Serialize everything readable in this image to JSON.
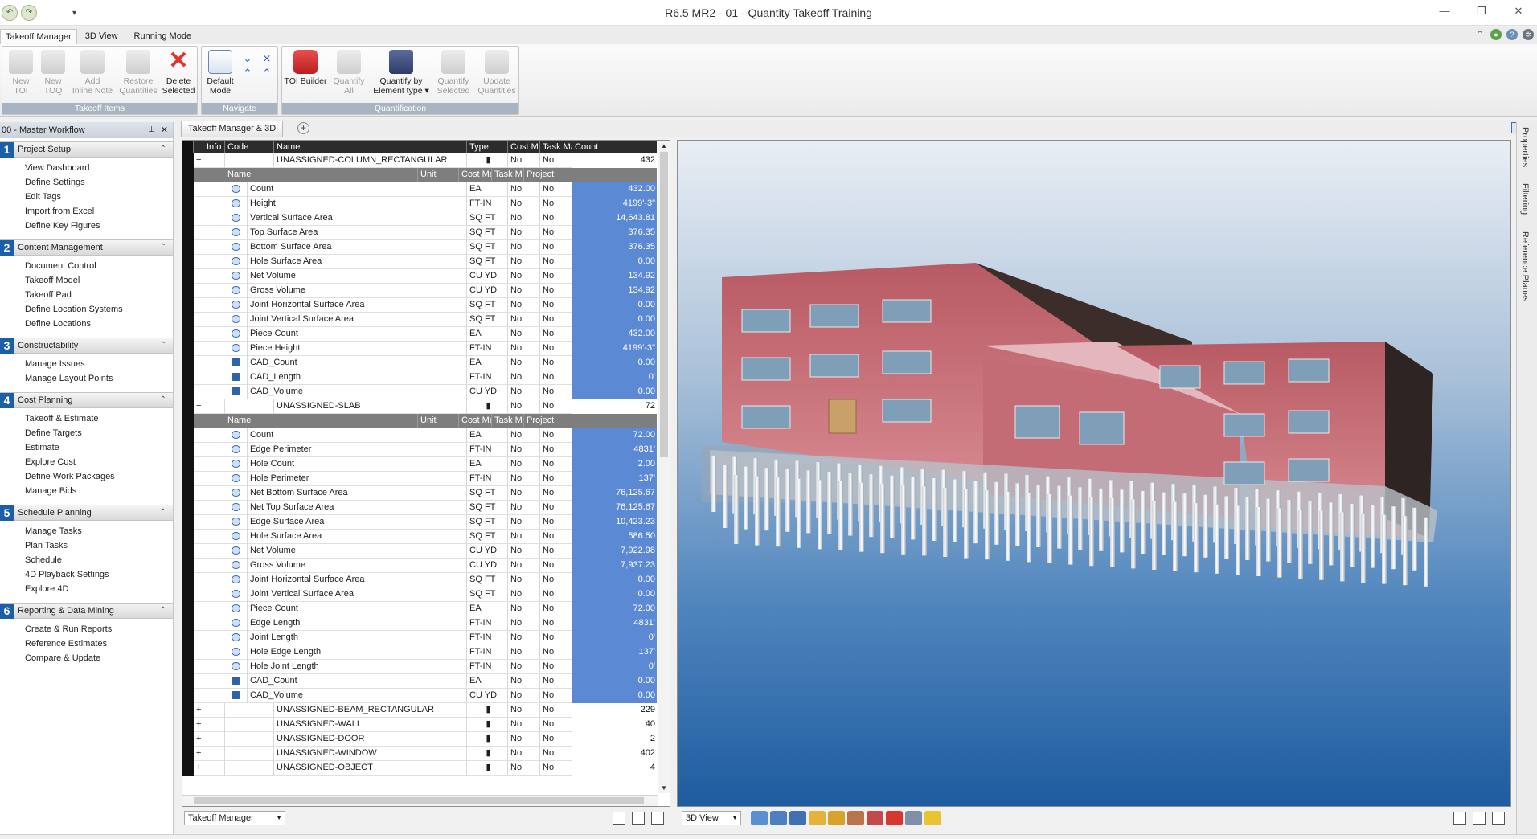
{
  "window": {
    "title": "R6.5 MR2 - 01 - Quantity Takeoff Training"
  },
  "ribbon_tabs": [
    "Takeoff Manager",
    "3D View",
    "Running Mode"
  ],
  "ribbon": {
    "takeoff_items": {
      "label": "Takeoff Items",
      "buttons": [
        {
          "l1": "New",
          "l2": "TOI"
        },
        {
          "l1": "New",
          "l2": "TOQ"
        },
        {
          "l1": "Add",
          "l2": "Inline Note"
        },
        {
          "l1": "Restore",
          "l2": "Quantities"
        },
        {
          "l1": "Delete",
          "l2": "Selected"
        }
      ]
    },
    "navigate": {
      "label": "Navigate",
      "default_l1": "Default",
      "default_l2": "Mode"
    },
    "quantification": {
      "label": "Quantification",
      "buttons": [
        {
          "l1": "TOI Builder",
          "l2": ""
        },
        {
          "l1": "Quantify",
          "l2": "All"
        },
        {
          "l1": "Quantify by",
          "l2": "Element type ▾"
        },
        {
          "l1": "Quantify",
          "l2": "Selected"
        },
        {
          "l1": "Update",
          "l2": "Quantities"
        }
      ]
    }
  },
  "workflow": {
    "title": "00 - Master Workflow",
    "sections": [
      {
        "num": "1",
        "title": "Project Setup",
        "items": [
          "View Dashboard",
          "Define Settings",
          "Edit Tags",
          "Import from Excel",
          "Define Key Figures"
        ]
      },
      {
        "num": "2",
        "title": "Content Management",
        "items": [
          "Document Control",
          "Takeoff Model",
          "Takeoff Pad",
          "Define Location Systems",
          "Define Locations"
        ]
      },
      {
        "num": "3",
        "title": "Constructability",
        "items": [
          "Manage Issues",
          "Manage Layout Points"
        ]
      },
      {
        "num": "4",
        "title": "Cost Planning",
        "items": [
          "Takeoff & Estimate",
          "Define Targets",
          "Estimate",
          "Explore Cost",
          "Define Work Packages",
          "Manage Bids"
        ]
      },
      {
        "num": "5",
        "title": "Schedule Planning",
        "items": [
          "Manage Tasks",
          "Plan Tasks",
          "Schedule",
          "4D Playback Settings",
          "Explore 4D"
        ]
      },
      {
        "num": "6",
        "title": "Reporting & Data Mining",
        "items": [
          "Create & Run Reports",
          "Reference Estimates",
          "Compare & Update"
        ]
      }
    ]
  },
  "doc_tab": "Takeoff Manager & 3D",
  "grid": {
    "headers": [
      "Info",
      "Code",
      "Name",
      "Type",
      "Cost Ma",
      "Task Ma",
      "Count"
    ],
    "subheaders": [
      "Name",
      "Unit",
      "Cost Ma",
      "Task Ma",
      "Project"
    ],
    "groups": [
      {
        "toggle": "−",
        "name": "UNASSIGNED-COLUMN_RECTANGULAR",
        "cost": "No",
        "task": "No",
        "count": "432",
        "rows": [
          {
            "icon": "toq",
            "name": "Count",
            "unit": "EA",
            "cost": "No",
            "task": "No",
            "value": "432.00"
          },
          {
            "icon": "toq",
            "name": "Height",
            "unit": "FT-IN",
            "cost": "No",
            "task": "No",
            "value": "4199'-3\""
          },
          {
            "icon": "toq",
            "name": "Vertical Surface Area",
            "unit": "SQ FT",
            "cost": "No",
            "task": "No",
            "value": "14,643.81"
          },
          {
            "icon": "toq",
            "name": "Top Surface Area",
            "unit": "SQ FT",
            "cost": "No",
            "task": "No",
            "value": "376.35"
          },
          {
            "icon": "toq",
            "name": "Bottom Surface Area",
            "unit": "SQ FT",
            "cost": "No",
            "task": "No",
            "value": "376.35"
          },
          {
            "icon": "toq",
            "name": "Hole Surface Area",
            "unit": "SQ FT",
            "cost": "No",
            "task": "No",
            "value": "0.00"
          },
          {
            "icon": "toq",
            "name": "Net Volume",
            "unit": "CU YD",
            "cost": "No",
            "task": "No",
            "value": "134.92"
          },
          {
            "icon": "toq",
            "name": "Gross Volume",
            "unit": "CU YD",
            "cost": "No",
            "task": "No",
            "value": "134.92"
          },
          {
            "icon": "toq",
            "name": "Joint Horizontal Surface Area",
            "unit": "SQ FT",
            "cost": "No",
            "task": "No",
            "value": "0.00"
          },
          {
            "icon": "toq",
            "name": "Joint Vertical Surface Area",
            "unit": "SQ FT",
            "cost": "No",
            "task": "No",
            "value": "0.00"
          },
          {
            "icon": "toq",
            "name": "Piece Count",
            "unit": "EA",
            "cost": "No",
            "task": "No",
            "value": "432.00"
          },
          {
            "icon": "toq",
            "name": "Piece Height",
            "unit": "FT-IN",
            "cost": "No",
            "task": "No",
            "value": "4199'-3\""
          },
          {
            "icon": "cad",
            "name": "CAD_Count",
            "unit": "EA",
            "cost": "No",
            "task": "No",
            "value": "0.00"
          },
          {
            "icon": "cad",
            "name": "CAD_Length",
            "unit": "FT-IN",
            "cost": "No",
            "task": "No",
            "value": "0'"
          },
          {
            "icon": "cad",
            "name": "CAD_Volume",
            "unit": "CU YD",
            "cost": "No",
            "task": "No",
            "value": "0.00"
          }
        ]
      },
      {
        "toggle": "−",
        "name": "UNASSIGNED-SLAB",
        "cost": "No",
        "task": "No",
        "count": "72",
        "rows": [
          {
            "icon": "toq",
            "name": "Count",
            "unit": "EA",
            "cost": "No",
            "task": "No",
            "value": "72.00"
          },
          {
            "icon": "toq",
            "name": "Edge Perimeter",
            "unit": "FT-IN",
            "cost": "No",
            "task": "No",
            "value": "4831'"
          },
          {
            "icon": "toq",
            "name": "Hole Count",
            "unit": "EA",
            "cost": "No",
            "task": "No",
            "value": "2.00"
          },
          {
            "icon": "toq",
            "name": "Hole Perimeter",
            "unit": "FT-IN",
            "cost": "No",
            "task": "No",
            "value": "137'"
          },
          {
            "icon": "toq",
            "name": "Net Bottom Surface Area",
            "unit": "SQ FT",
            "cost": "No",
            "task": "No",
            "value": "76,125.67"
          },
          {
            "icon": "toq",
            "name": "Net Top Surface Area",
            "unit": "SQ FT",
            "cost": "No",
            "task": "No",
            "value": "76,125.67"
          },
          {
            "icon": "toq",
            "name": "Edge Surface Area",
            "unit": "SQ FT",
            "cost": "No",
            "task": "No",
            "value": "10,423.23"
          },
          {
            "icon": "toq",
            "name": "Hole Surface Area",
            "unit": "SQ FT",
            "cost": "No",
            "task": "No",
            "value": "586.50"
          },
          {
            "icon": "toq",
            "name": "Net Volume",
            "unit": "CU YD",
            "cost": "No",
            "task": "No",
            "value": "7,922.98"
          },
          {
            "icon": "toq",
            "name": "Gross Volume",
            "unit": "CU YD",
            "cost": "No",
            "task": "No",
            "value": "7,937.23"
          },
          {
            "icon": "toq",
            "name": "Joint Horizontal Surface Area",
            "unit": "SQ FT",
            "cost": "No",
            "task": "No",
            "value": "0.00"
          },
          {
            "icon": "toq",
            "name": "Joint Vertical Surface Area",
            "unit": "SQ FT",
            "cost": "No",
            "task": "No",
            "value": "0.00"
          },
          {
            "icon": "toq",
            "name": "Piece Count",
            "unit": "EA",
            "cost": "No",
            "task": "No",
            "value": "72.00"
          },
          {
            "icon": "toq",
            "name": "Edge Length",
            "unit": "FT-IN",
            "cost": "No",
            "task": "No",
            "value": "4831'"
          },
          {
            "icon": "toq",
            "name": "Joint Length",
            "unit": "FT-IN",
            "cost": "No",
            "task": "No",
            "value": "0'"
          },
          {
            "icon": "toq",
            "name": "Hole Edge Length",
            "unit": "FT-IN",
            "cost": "No",
            "task": "No",
            "value": "137'"
          },
          {
            "icon": "toq",
            "name": "Hole Joint Length",
            "unit": "FT-IN",
            "cost": "No",
            "task": "No",
            "value": "0'"
          },
          {
            "icon": "cad",
            "name": "CAD_Count",
            "unit": "EA",
            "cost": "No",
            "task": "No",
            "value": "0.00"
          },
          {
            "icon": "cad",
            "name": "CAD_Volume",
            "unit": "CU YD",
            "cost": "No",
            "task": "No",
            "value": "0.00"
          }
        ]
      },
      {
        "toggle": "+",
        "name": "UNASSIGNED-BEAM_RECTANGULAR",
        "cost": "No",
        "task": "No",
        "count": "229",
        "rows": []
      },
      {
        "toggle": "+",
        "name": "UNASSIGNED-WALL",
        "cost": "No",
        "task": "No",
        "count": "40",
        "rows": []
      },
      {
        "toggle": "+",
        "name": "UNASSIGNED-DOOR",
        "cost": "No",
        "task": "No",
        "count": "2",
        "rows": []
      },
      {
        "toggle": "+",
        "name": "UNASSIGNED-WINDOW",
        "cost": "No",
        "task": "No",
        "count": "402",
        "rows": []
      },
      {
        "toggle": "+",
        "name": "UNASSIGNED-OBJECT",
        "cost": "No",
        "task": "No",
        "count": "4",
        "rows": []
      }
    ]
  },
  "bottom_left": {
    "combo": "Takeoff Manager"
  },
  "bottom_right": {
    "combo": "3D View"
  },
  "right_strip": [
    "Properties",
    "Filtering",
    "Reference Planes"
  ],
  "colors": {
    "accent": "#1b5fa8",
    "value_cell": "#5b89d4",
    "header": "#2c2c2c"
  }
}
